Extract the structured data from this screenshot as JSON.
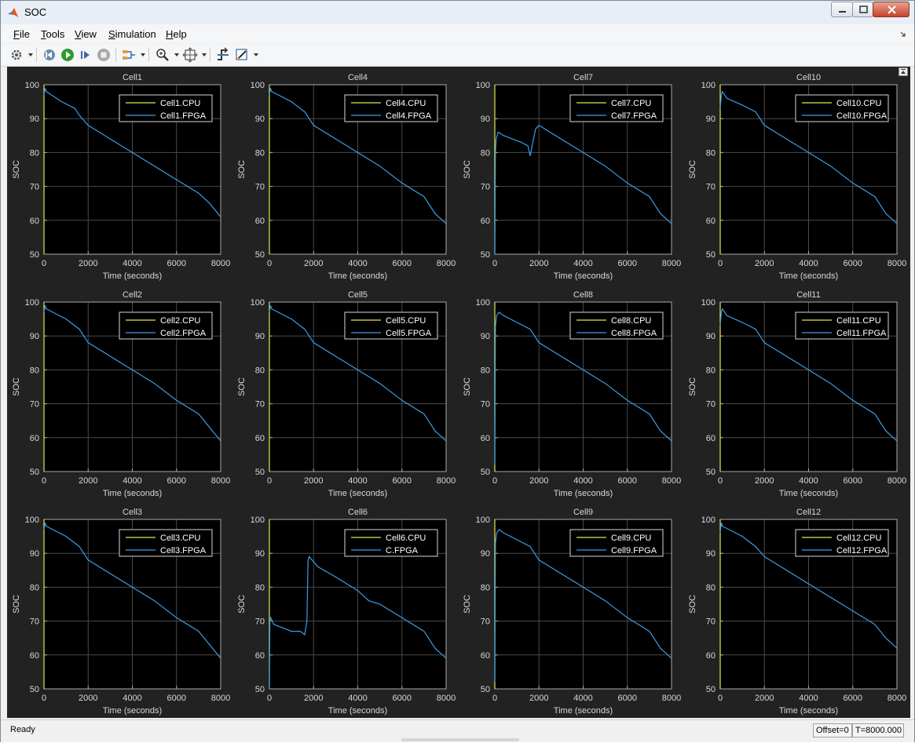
{
  "window": {
    "title": "SOC"
  },
  "menu": [
    {
      "label": "File"
    },
    {
      "label": "Tools"
    },
    {
      "label": "View"
    },
    {
      "label": "Simulation"
    },
    {
      "label": "Help"
    }
  ],
  "toolbar": {
    "icons": [
      "settings-icon",
      "step-back-icon",
      "run-icon",
      "step-forward-icon",
      "stop-icon",
      "signal-selector-icon",
      "zoom-icon",
      "fit-to-view-icon",
      "trigger-icon",
      "style-icon"
    ]
  },
  "status": {
    "text": "Ready",
    "offset": "Offset=0",
    "time": "T=8000.000"
  },
  "colors": {
    "background": "#222222",
    "cpu": "#e5e54c",
    "fpga": "#3b9ee8",
    "axis": "#aaaaaa",
    "grid": "#4a4a4a"
  },
  "chart_data": [
    {
      "type": "line",
      "title": "Cell1",
      "xlabel": "Time (seconds)",
      "ylabel": "SOC",
      "xlim": [
        0,
        8000
      ],
      "ylim": [
        50,
        100
      ],
      "xticks": [
        "0",
        "2000",
        "4000",
        "6000",
        "8000"
      ],
      "yticks": [
        "50",
        "60",
        "70",
        "80",
        "90",
        "100"
      ],
      "grid": true,
      "legend_position": "top-right",
      "series": [
        {
          "name": "Cell1.CPU",
          "x": [
            0,
            0
          ],
          "y": [
            50,
            100
          ]
        },
        {
          "name": "Cell1.FPGA",
          "x": [
            0,
            50,
            100,
            800,
            1400,
            1600,
            2000,
            3000,
            4000,
            5000,
            6000,
            7000,
            7500,
            8000
          ],
          "y": [
            97,
            99,
            98,
            95,
            93,
            91,
            88,
            84,
            80,
            76,
            72,
            68,
            65,
            61
          ]
        }
      ]
    },
    {
      "type": "line",
      "title": "Cell2",
      "xlabel": "Time (seconds)",
      "ylabel": "SOC",
      "xlim": [
        0,
        8000
      ],
      "ylim": [
        50,
        100
      ],
      "xticks": [
        "0",
        "2000",
        "4000",
        "6000",
        "8000"
      ],
      "yticks": [
        "50",
        "60",
        "70",
        "80",
        "90",
        "100"
      ],
      "grid": true,
      "legend_position": "top-right",
      "series": [
        {
          "name": "Cell2.CPU",
          "x": [
            0,
            0
          ],
          "y": [
            50,
            100
          ]
        },
        {
          "name": "Cell2.FPGA",
          "x": [
            0,
            50,
            100,
            1000,
            1600,
            2000,
            3000,
            4000,
            5000,
            6000,
            7000,
            7500,
            8000
          ],
          "y": [
            97,
            99,
            98,
            95,
            92,
            88,
            84,
            80,
            76,
            71,
            67,
            63,
            59
          ]
        }
      ]
    },
    {
      "type": "line",
      "title": "Cell3",
      "xlabel": "Time (seconds)",
      "ylabel": "SOC",
      "xlim": [
        0,
        8000
      ],
      "ylim": [
        50,
        100
      ],
      "xticks": [
        "0",
        "2000",
        "4000",
        "6000",
        "8000"
      ],
      "yticks": [
        "50",
        "60",
        "70",
        "80",
        "90",
        "100"
      ],
      "grid": true,
      "legend_position": "top-right",
      "series": [
        {
          "name": "Cell3.CPU",
          "x": [
            0,
            0
          ],
          "y": [
            50,
            100
          ]
        },
        {
          "name": "Cell3.FPGA",
          "x": [
            0,
            50,
            100,
            1000,
            1600,
            2000,
            3000,
            4000,
            5000,
            6000,
            7000,
            7500,
            8000
          ],
          "y": [
            97,
            99,
            98,
            95,
            92,
            88,
            84,
            80,
            76,
            71,
            67,
            63,
            59
          ]
        }
      ]
    },
    {
      "type": "line",
      "title": "Cell4",
      "xlabel": "Time (seconds)",
      "ylabel": "SOC",
      "xlim": [
        0,
        8000
      ],
      "ylim": [
        50,
        100
      ],
      "xticks": [
        "0",
        "2000",
        "4000",
        "6000",
        "8000"
      ],
      "yticks": [
        "50",
        "60",
        "70",
        "80",
        "90",
        "100"
      ],
      "grid": true,
      "legend_position": "top-right",
      "series": [
        {
          "name": "Cell4.CPU",
          "x": [
            0,
            0
          ],
          "y": [
            50,
            100
          ]
        },
        {
          "name": "Cell4.FPGA",
          "x": [
            0,
            50,
            100,
            1000,
            1600,
            2000,
            3000,
            4000,
            5000,
            6000,
            7000,
            7500,
            8000
          ],
          "y": [
            97,
            99,
            98,
            95,
            92,
            88,
            84,
            80,
            76,
            71,
            67,
            62,
            59
          ]
        }
      ]
    },
    {
      "type": "line",
      "title": "Cell5",
      "xlabel": "Time (seconds)",
      "ylabel": "SOC",
      "xlim": [
        0,
        8000
      ],
      "ylim": [
        50,
        100
      ],
      "xticks": [
        "0",
        "2000",
        "4000",
        "6000",
        "8000"
      ],
      "yticks": [
        "50",
        "60",
        "70",
        "80",
        "90",
        "100"
      ],
      "grid": true,
      "legend_position": "top-right",
      "series": [
        {
          "name": "Cell5.CPU",
          "x": [
            0,
            0
          ],
          "y": [
            50,
            100
          ]
        },
        {
          "name": "Cell5.FPGA",
          "x": [
            0,
            50,
            100,
            1000,
            1600,
            2000,
            3000,
            4000,
            5000,
            6000,
            7000,
            7500,
            8000
          ],
          "y": [
            97,
            99,
            98,
            95,
            92,
            88,
            84,
            80,
            76,
            71,
            67,
            62,
            59
          ]
        }
      ]
    },
    {
      "type": "line",
      "title": "Cell6",
      "xlabel": "Time (seconds)",
      "ylabel": "SOC",
      "xlim": [
        0,
        8000
      ],
      "ylim": [
        50,
        100
      ],
      "xticks": [
        "0",
        "2000",
        "4000",
        "6000",
        "8000"
      ],
      "yticks": [
        "50",
        "60",
        "70",
        "80",
        "90",
        "100"
      ],
      "grid": true,
      "legend_position": "top-right",
      "series": [
        {
          "name": "Cell6.CPU",
          "x": [
            0,
            0
          ],
          "y": [
            50,
            100
          ]
        },
        {
          "name": "C.FPGA",
          "x": [
            0,
            20,
            60,
            200,
            600,
            1000,
            1400,
            1600,
            1700,
            1750,
            1800,
            2200,
            3000,
            4000,
            4500,
            5000,
            6000,
            7000,
            7500,
            8000
          ],
          "y": [
            50,
            70,
            71,
            69,
            68,
            67,
            67,
            66,
            70,
            88,
            89,
            86,
            83,
            79,
            76,
            75,
            71,
            67,
            62,
            59
          ]
        }
      ]
    },
    {
      "type": "line",
      "title": "Cell7",
      "xlabel": "Time (seconds)",
      "ylabel": "SOC",
      "xlim": [
        0,
        8000
      ],
      "ylim": [
        50,
        100
      ],
      "xticks": [
        "0",
        "2000",
        "4000",
        "6000",
        "8000"
      ],
      "yticks": [
        "50",
        "60",
        "70",
        "80",
        "90",
        "100"
      ],
      "grid": true,
      "legend_position": "top-right",
      "series": [
        {
          "name": "Cell7.CPU",
          "x": [
            0,
            0
          ],
          "y": [
            50,
            100
          ]
        },
        {
          "name": "Cell7.FPGA",
          "x": [
            0,
            30,
            60,
            150,
            400,
            800,
            1200,
            1500,
            1600,
            1750,
            1850,
            2000,
            2500,
            3000,
            4000,
            5000,
            6000,
            7000,
            7500,
            8000
          ],
          "y": [
            50,
            80,
            84,
            86,
            85,
            84,
            83,
            82,
            79,
            84,
            87,
            88,
            86,
            84,
            80,
            76,
            71,
            67,
            62,
            59
          ]
        }
      ]
    },
    {
      "type": "line",
      "title": "Cell8",
      "xlabel": "Time (seconds)",
      "ylabel": "SOC",
      "xlim": [
        0,
        8000
      ],
      "ylim": [
        50,
        100
      ],
      "xticks": [
        "0",
        "2000",
        "4000",
        "6000",
        "8000"
      ],
      "yticks": [
        "50",
        "60",
        "70",
        "80",
        "90",
        "100"
      ],
      "grid": true,
      "legend_position": "top-right",
      "series": [
        {
          "name": "Cell8.CPU",
          "x": [
            0,
            0
          ],
          "y": [
            50,
            100
          ]
        },
        {
          "name": "Cell8.FPGA",
          "x": [
            0,
            30,
            80,
            200,
            400,
            1000,
            1600,
            2000,
            3000,
            4000,
            5000,
            6000,
            7000,
            7500,
            8000
          ],
          "y": [
            52,
            93,
            96,
            97,
            96,
            94,
            92,
            88,
            84,
            80,
            76,
            71,
            67,
            62,
            59
          ]
        }
      ]
    },
    {
      "type": "line",
      "title": "Cell9",
      "xlabel": "Time (seconds)",
      "ylabel": "SOC",
      "xlim": [
        0,
        8000
      ],
      "ylim": [
        50,
        100
      ],
      "xticks": [
        "0",
        "2000",
        "4000",
        "6000",
        "8000"
      ],
      "yticks": [
        "50",
        "60",
        "70",
        "80",
        "90",
        "100"
      ],
      "grid": true,
      "legend_position": "top-right",
      "series": [
        {
          "name": "Cell9.CPU",
          "x": [
            0,
            0
          ],
          "y": [
            50,
            100
          ]
        },
        {
          "name": "Cell9.FPGA",
          "x": [
            0,
            30,
            80,
            200,
            400,
            1000,
            1600,
            2000,
            3000,
            4000,
            5000,
            6000,
            7000,
            7500,
            8000
          ],
          "y": [
            52,
            93,
            96,
            97,
            96,
            94,
            92,
            88,
            84,
            80,
            76,
            71,
            67,
            62,
            59
          ]
        }
      ]
    },
    {
      "type": "line",
      "title": "Cell10",
      "xlabel": "Time (seconds)",
      "ylabel": "SOC",
      "xlim": [
        0,
        8000
      ],
      "ylim": [
        50,
        100
      ],
      "xticks": [
        "0",
        "2000",
        "4000",
        "6000",
        "8000"
      ],
      "yticks": [
        "50",
        "60",
        "70",
        "80",
        "90",
        "100"
      ],
      "grid": true,
      "legend_position": "top-right",
      "series": [
        {
          "name": "Cell10.CPU",
          "x": [
            0,
            0
          ],
          "y": [
            50,
            100
          ]
        },
        {
          "name": "Cell10.FPGA",
          "x": [
            0,
            50,
            100,
            300,
            1000,
            1600,
            2000,
            3000,
            4000,
            5000,
            6000,
            7000,
            7500,
            8000
          ],
          "y": [
            93,
            97,
            98,
            96,
            94,
            92,
            88,
            84,
            80,
            76,
            71,
            67,
            62,
            59
          ]
        }
      ]
    },
    {
      "type": "line",
      "title": "Cell11",
      "xlabel": "Time (seconds)",
      "ylabel": "SOC",
      "xlim": [
        0,
        8000
      ],
      "ylim": [
        50,
        100
      ],
      "xticks": [
        "0",
        "2000",
        "4000",
        "6000",
        "8000"
      ],
      "yticks": [
        "50",
        "60",
        "70",
        "80",
        "90",
        "100"
      ],
      "grid": true,
      "legend_position": "top-right",
      "series": [
        {
          "name": "Cell11.CPU",
          "x": [
            0,
            0
          ],
          "y": [
            50,
            100
          ]
        },
        {
          "name": "Cell11.FPGA",
          "x": [
            0,
            50,
            100,
            300,
            1000,
            1600,
            2000,
            3000,
            4000,
            5000,
            6000,
            7000,
            7500,
            8000
          ],
          "y": [
            93,
            97,
            98,
            96,
            94,
            92,
            88,
            84,
            80,
            76,
            71,
            67,
            62,
            59
          ]
        }
      ]
    },
    {
      "type": "line",
      "title": "Cell12",
      "xlabel": "Time (seconds)",
      "ylabel": "SOC",
      "xlim": [
        0,
        8000
      ],
      "ylim": [
        50,
        100
      ],
      "xticks": [
        "0",
        "2000",
        "4000",
        "6000",
        "8000"
      ],
      "yticks": [
        "50",
        "60",
        "70",
        "80",
        "90",
        "100"
      ],
      "grid": true,
      "legend_position": "top-right",
      "series": [
        {
          "name": "Cell12.CPU",
          "x": [
            0,
            0
          ],
          "y": [
            50,
            100
          ]
        },
        {
          "name": "Cell12.FPGA",
          "x": [
            0,
            50,
            100,
            1000,
            1600,
            2000,
            3000,
            4000,
            5000,
            6000,
            7000,
            7500,
            8000
          ],
          "y": [
            96,
            99,
            98,
            95,
            92,
            89,
            85,
            81,
            77,
            73,
            69,
            65,
            62
          ]
        }
      ]
    }
  ]
}
